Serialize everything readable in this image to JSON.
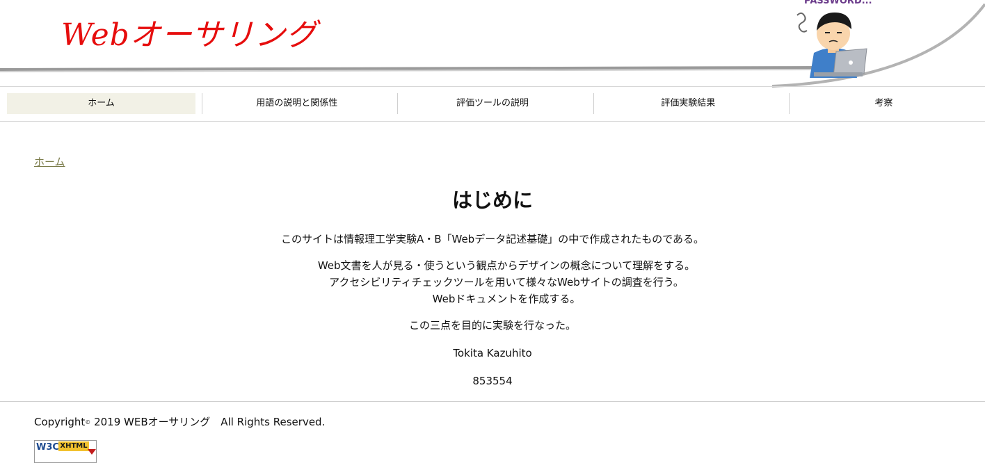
{
  "header": {
    "logo_text": "Webオーサリング",
    "illustration_label": "PASSWORD..."
  },
  "nav": {
    "items": [
      {
        "label": "ホーム",
        "active": true
      },
      {
        "label": "用語の説明と関係性",
        "active": false
      },
      {
        "label": "評価ツールの説明",
        "active": false
      },
      {
        "label": "評価実験結果",
        "active": false
      },
      {
        "label": "考察",
        "active": false
      }
    ]
  },
  "breadcrumb": {
    "label": "ホーム"
  },
  "main": {
    "heading": "はじめに",
    "intro": "このサイトは情報理工学実験A・B「Webデータ記述基礎」の中で作成されたものである。",
    "goals": [
      "Web文書を人が見る・使うという観点からデザインの概念について理解をする。",
      "アクセシビリティチェックツールを用いて様々なWebサイトの調査を行う。",
      "Webドキュメントを作成する。"
    ],
    "summary": "この三点を目的に実験を行なった。",
    "author": "Tokita Kazuhito",
    "student_id": "853554"
  },
  "footer": {
    "copyright_prefix": "Copyright",
    "copyright_symbol": "©",
    "copyright_rest": " 2019 WEBオーサリング　All Rights Reserved.",
    "badge": {
      "w3c": "W3C",
      "xhtml": "XHTML"
    }
  },
  "colors": {
    "logo": "#e60d0d",
    "breadcrumb": "#7b7c4a",
    "nav_active_bg": "#f2f1e6"
  }
}
